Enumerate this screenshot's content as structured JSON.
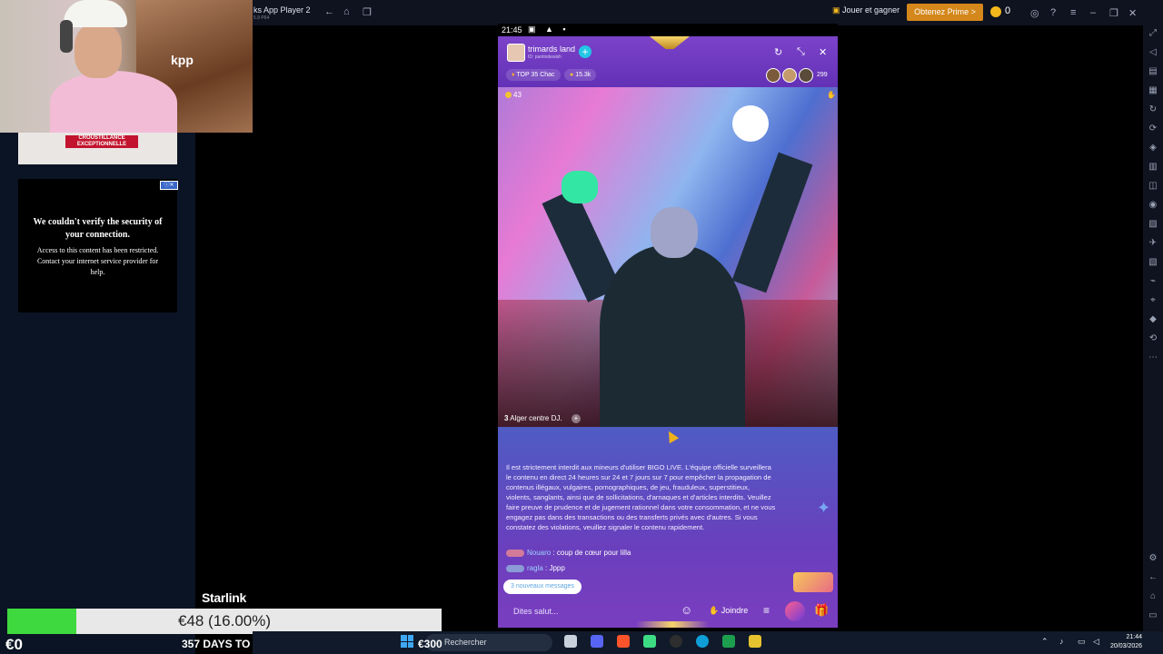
{
  "stream_overlay": {
    "promo_badge": "CROUSTILLANCE EXCEPTIONNELLE",
    "security_title": "We couldn't verify the security of your connection.",
    "security_text": "Access to this content has been restricted. Contact your internet service provider for help.",
    "ad_label": "ⓘ✕",
    "webcam_poster_text": "kpp",
    "goal_label": "Starlink",
    "goal_text": "€48 (16.00%)",
    "goal_progress": 0.16,
    "donation_amount": "€0",
    "days_to_go": "357 DAYS TO GO",
    "colors": {
      "goal_fill": "#3ed93e",
      "goal_bg": "#e8e8e8"
    }
  },
  "emulator": {
    "app_title": "ks App Player 2",
    "app_subtitle": "5.9 P64",
    "nav_icons": [
      "back-icon",
      "home-icon",
      "multitask-icon"
    ],
    "play_earn_label": "Jouer et gagner",
    "prime_label": "Obtenez Prime >",
    "coin_count": "0",
    "colors": {
      "prime": "#d4871a",
      "coin": "#f2b81c"
    }
  },
  "phone": {
    "status_time": "21:45",
    "status_icons": "▣ ▲ ▪",
    "host_name": "trimards land",
    "host_id": "ID: pantindewish",
    "rank_label": "TOP 35 Chac",
    "beans_label": "15.3k",
    "viewer_count": "299",
    "likes_count": "43",
    "room_rank": "3",
    "room_caption": "Alger centre DJ.",
    "rules_text": "Il est strictement interdit aux mineurs d'utiliser BIGO LIVE. L'équipe officielle surveillera le contenu en direct 24 heures sur 24 et 7 jours sur 7 pour empêcher la propagation de contenus illégaux, vulgaires, pornographiques, de jeu, frauduleux, superstitieux, violents, sanglants, ainsi que de sollicitations, d'arnaques et d'articles interdits. Veuillez faire preuve de prudence et de jugement rationnel dans votre consommation, et ne vous engagez pas dans des transactions ou des transferts privés avec d'autres. Si vous constatez des violations, veuillez signaler le contenu rapidement.",
    "chat": [
      {
        "user": "Nouaro",
        "message": ": coup de cœur pour lilla",
        "level": "5"
      },
      {
        "user": "ragla",
        "message": ": Jppp",
        "level": "14"
      }
    ],
    "new_messages_label": "3 nouveaux messages",
    "input_placeholder": "Dites salut...",
    "join_label": "Joindre",
    "colors": {
      "header": "#7b43c9",
      "accent": "#23c7e6",
      "chat_bg": "#5a4ec4"
    }
  },
  "taskbar": {
    "search_label": "Rechercher",
    "price_tag": "€300",
    "time": "21:44",
    "date": "20/03/2026"
  }
}
